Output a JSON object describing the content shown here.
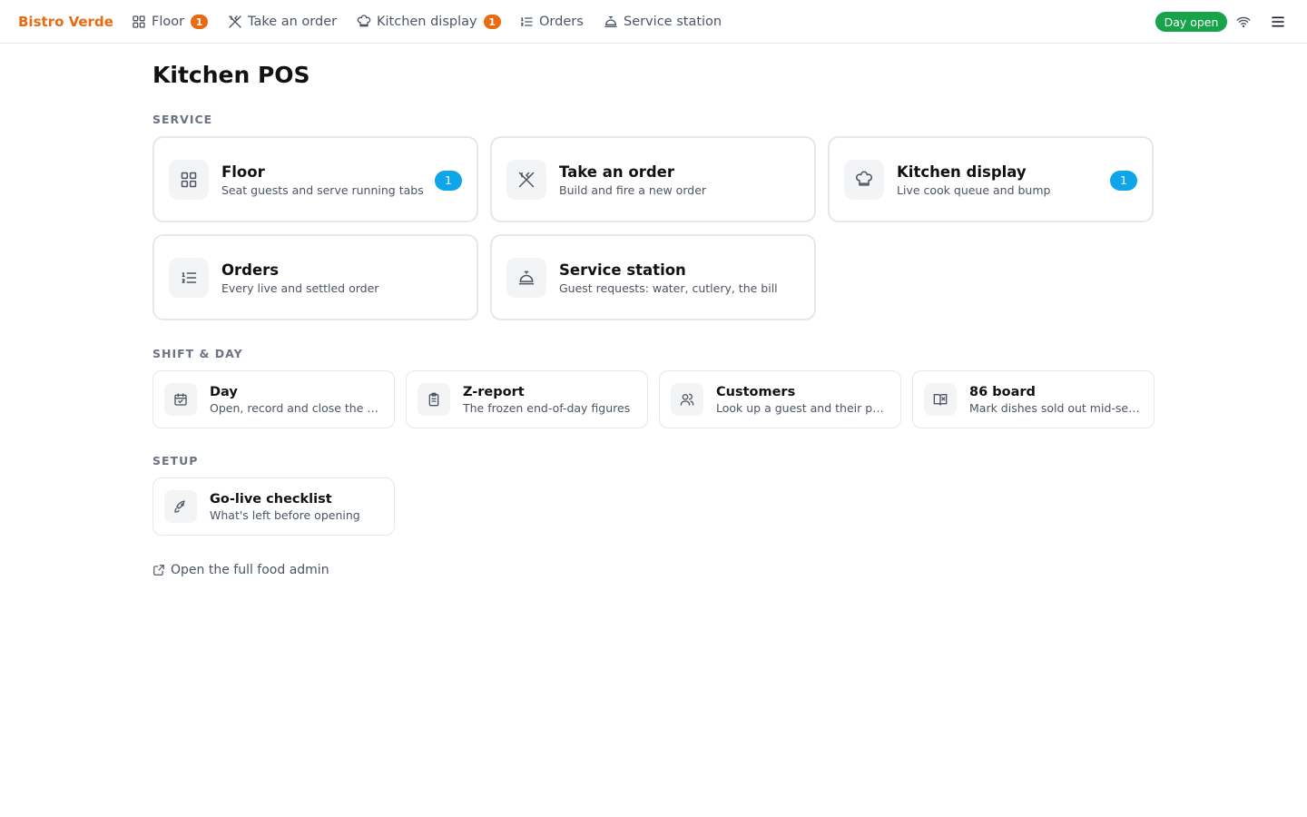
{
  "nav": {
    "brand": "Bistro Verde",
    "links": [
      {
        "label": "Floor",
        "icon": "grid-icon",
        "badge": "1"
      },
      {
        "label": "Take an order",
        "icon": "utensils-crossed-icon"
      },
      {
        "label": "Kitchen display",
        "icon": "chef-hat-icon",
        "badge": "1"
      },
      {
        "label": "Orders",
        "icon": "list-ordered-icon"
      },
      {
        "label": "Service station",
        "icon": "concierge-bell-icon"
      }
    ],
    "status_badge": "Day open",
    "status_color": "#16a34a",
    "brand_color": "#ea6a12"
  },
  "page": {
    "title": "Kitchen POS"
  },
  "sections": {
    "service": {
      "heading": "SERVICE",
      "cards": [
        {
          "title": "Floor",
          "subtitle": "Seat guests and serve running tabs",
          "badge": "1",
          "icon": "grid-icon"
        },
        {
          "title": "Take an order",
          "subtitle": "Build and fire a new order",
          "icon": "utensils-crossed-icon"
        },
        {
          "title": "Kitchen display",
          "subtitle": "Live cook queue and bump",
          "badge": "1",
          "icon": "chef-hat-icon"
        },
        {
          "title": "Orders",
          "subtitle": "Every live and settled order",
          "icon": "list-ordered-icon"
        },
        {
          "title": "Service station",
          "subtitle": "Guest requests: water, cutlery, the bill",
          "icon": "concierge-bell-icon"
        }
      ]
    },
    "shift": {
      "heading": "SHIFT & DAY",
      "cards": [
        {
          "title": "Day",
          "subtitle": "Open, record and close the day",
          "icon": "calendar-check-icon"
        },
        {
          "title": "Z-report",
          "subtitle": "The frozen end-of-day figures",
          "icon": "clipboard-icon"
        },
        {
          "title": "Customers",
          "subtitle": "Look up a guest and their points",
          "icon": "users-icon"
        },
        {
          "title": "86 board",
          "subtitle": "Mark dishes sold out mid-service",
          "icon": "book-x-icon"
        }
      ]
    },
    "setup": {
      "heading": "SETUP",
      "cards": [
        {
          "title": "Go-live checklist",
          "subtitle": "What's left before opening",
          "icon": "rocket-icon"
        }
      ]
    }
  },
  "footer_link": {
    "label": "Open the full food admin",
    "icon": "external-link-icon"
  },
  "accent_badge_color": "#0ea5e9"
}
